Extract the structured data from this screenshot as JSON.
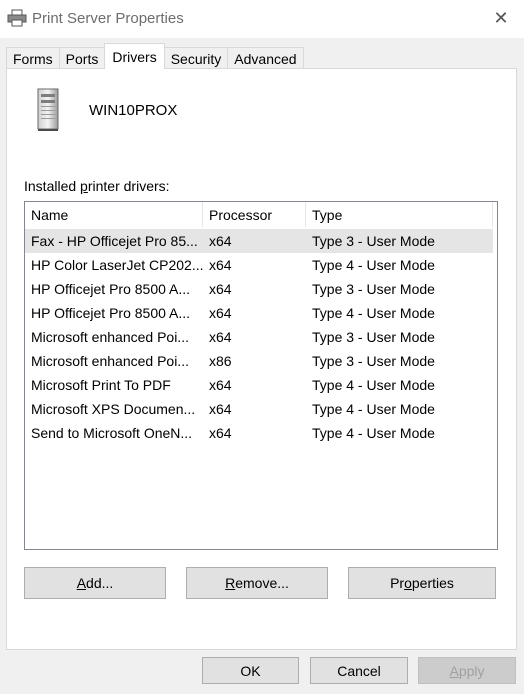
{
  "window": {
    "title": "Print Server Properties"
  },
  "tabs": [
    {
      "label": "Forms"
    },
    {
      "label": "Ports"
    },
    {
      "label": "Drivers"
    },
    {
      "label": "Security"
    },
    {
      "label": "Advanced"
    }
  ],
  "active_tab": "Drivers",
  "server": {
    "name": "WIN10PROX",
    "icon": "server-tower-icon"
  },
  "drivers": {
    "label_prefix": "Installed ",
    "label_mnemonic": "p",
    "label_suffix": "rinter drivers:",
    "columns": {
      "name": "Name",
      "processor": "Processor",
      "type": "Type"
    },
    "rows": [
      {
        "name": "Fax - HP Officejet Pro 85...",
        "processor": "x64",
        "type": "Type 3 - User Mode"
      },
      {
        "name": "HP Color LaserJet CP202...",
        "processor": "x64",
        "type": "Type 4 - User Mode"
      },
      {
        "name": "HP Officejet Pro 8500 A...",
        "processor": "x64",
        "type": "Type 3 - User Mode"
      },
      {
        "name": "HP Officejet Pro 8500 A...",
        "processor": "x64",
        "type": "Type 4 - User Mode"
      },
      {
        "name": "Microsoft enhanced Poi...",
        "processor": "x64",
        "type": "Type 3 - User Mode"
      },
      {
        "name": "Microsoft enhanced Poi...",
        "processor": "x86",
        "type": "Type 3 - User Mode"
      },
      {
        "name": "Microsoft Print To PDF",
        "processor": "x64",
        "type": "Type 4 - User Mode"
      },
      {
        "name": "Microsoft XPS Documen...",
        "processor": "x64",
        "type": "Type 4 - User Mode"
      },
      {
        "name": "Send to Microsoft OneN...",
        "processor": "x64",
        "type": "Type 4 - User Mode"
      }
    ]
  },
  "buttons": {
    "add_mnemonic": "A",
    "add_rest": "dd...",
    "remove_mnemonic": "R",
    "remove_rest": "emove...",
    "properties_pre": "Pr",
    "properties_mnemonic": "o",
    "properties_rest": "perties",
    "ok": "OK",
    "cancel": "Cancel",
    "apply_mnemonic": "A",
    "apply_rest": "pply"
  },
  "colors": {
    "selected_row": "#e5e5e5",
    "button_face": "#e1e1e1",
    "disabled_text": "#a0a0a0"
  }
}
